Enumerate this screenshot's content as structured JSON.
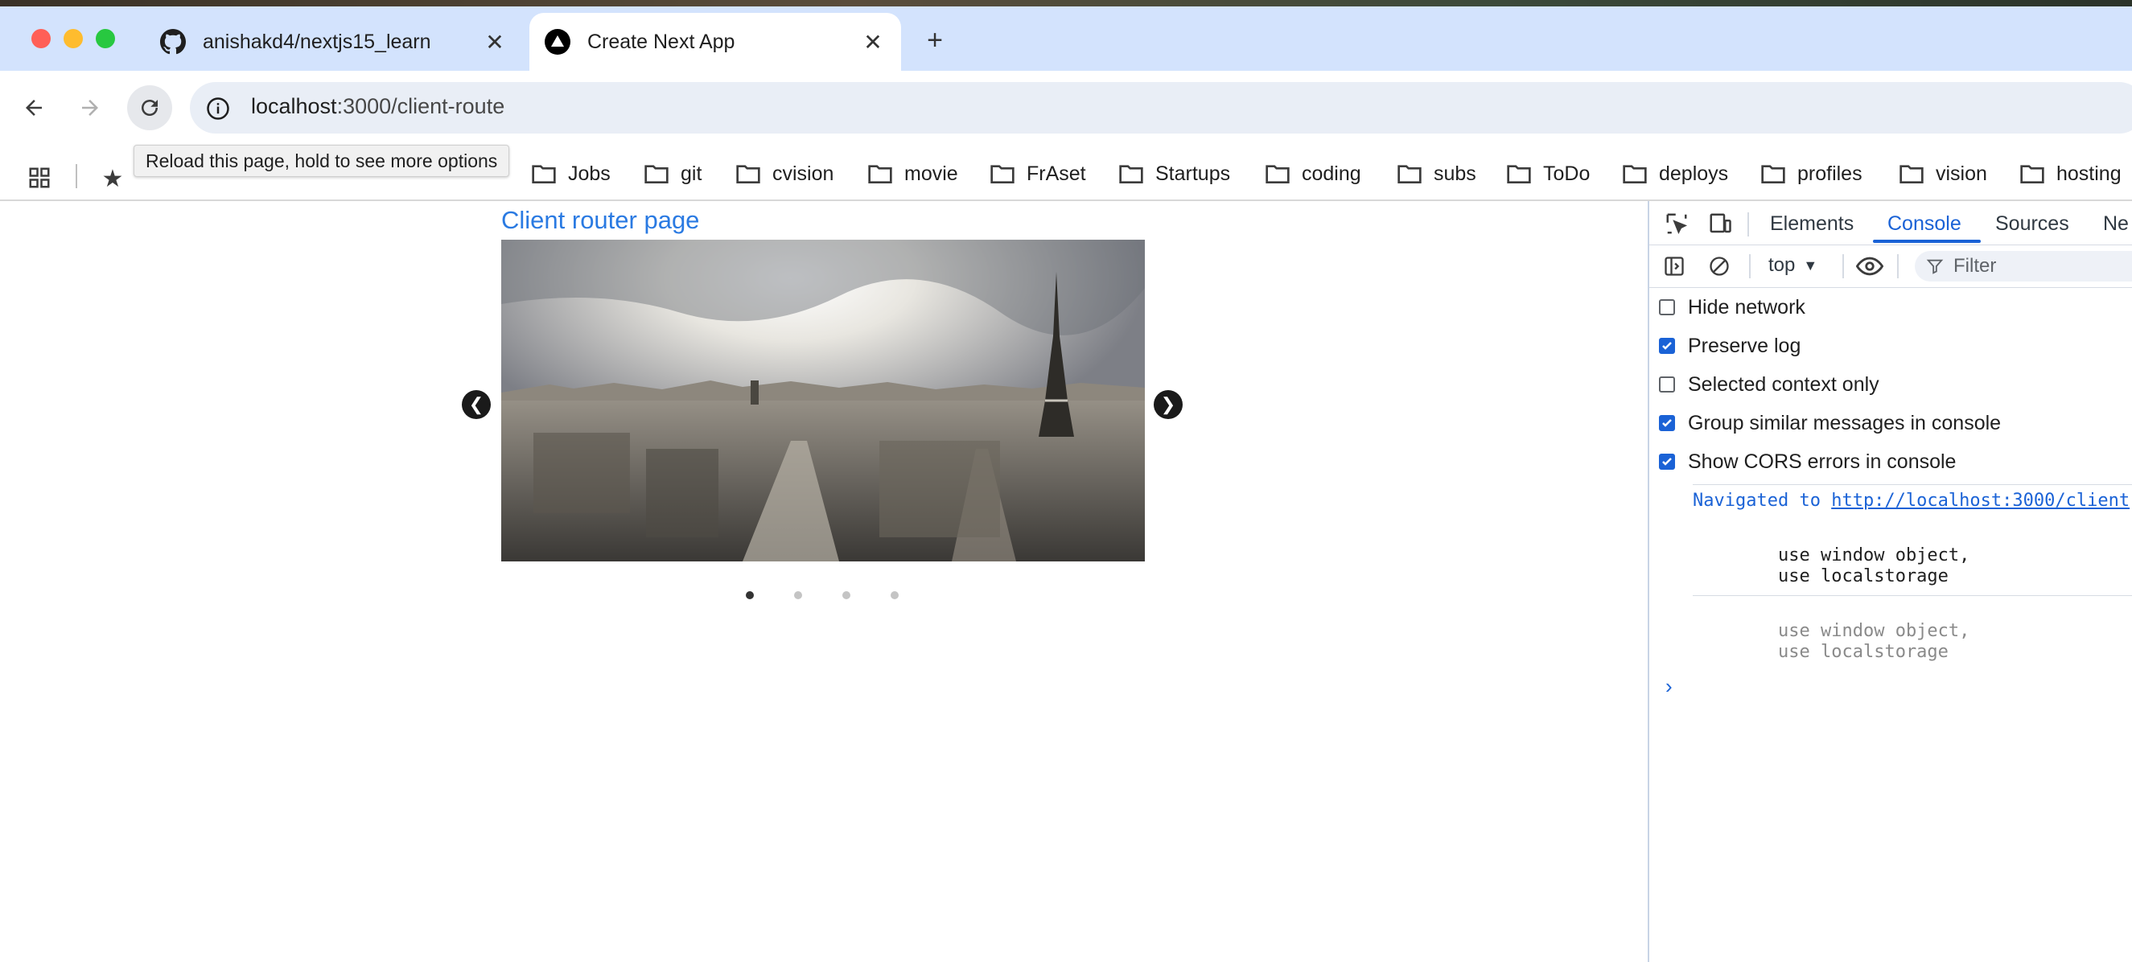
{
  "browser": {
    "tabs": [
      {
        "label": "anishakd4/nextjs15_learn",
        "icon": "github-icon",
        "active": false
      },
      {
        "label": "Create Next App",
        "icon": "nextjs-icon",
        "active": true
      }
    ],
    "new_tab": "+",
    "url_host": "localhost",
    "url_path": ":3000/client-route",
    "tooltip": "Reload this page, hold to see more options",
    "bookmarks": [
      "Jobs",
      "git",
      "cvision",
      "movie",
      "FrAset",
      "Startups",
      "coding",
      "subs",
      "ToDo",
      "deploys",
      "profiles",
      "vision",
      "hosting"
    ]
  },
  "page": {
    "title": "Client router page",
    "carousel": {
      "slides": 4,
      "active_slide": 1,
      "prev": "prev-arrow-icon",
      "next": "next-arrow-icon"
    }
  },
  "devtools": {
    "tabs": [
      "Elements",
      "Console",
      "Sources",
      "Ne"
    ],
    "active_tab": "Console",
    "context": "top",
    "filter_placeholder": "Filter",
    "options": [
      {
        "label": "Hide network",
        "checked": false
      },
      {
        "label": "Preserve log",
        "checked": true
      },
      {
        "label": "Selected context only",
        "checked": false
      },
      {
        "label": "Group similar messages in console",
        "checked": true
      },
      {
        "label": "Show CORS errors in console",
        "checked": true
      }
    ],
    "navigated_prefix": "Navigated to",
    "navigated_url": "http://localhost:3000/client",
    "log_line1": "use window object,",
    "log_line2": "use localstorage",
    "log2_line1": "use window object,",
    "log2_line2": "use localstorage",
    "prompt": "›"
  },
  "colors": {
    "tabbar": "#d3e3fd",
    "link": "#2a7ae2",
    "devtools_accent": "#1a62d6"
  }
}
